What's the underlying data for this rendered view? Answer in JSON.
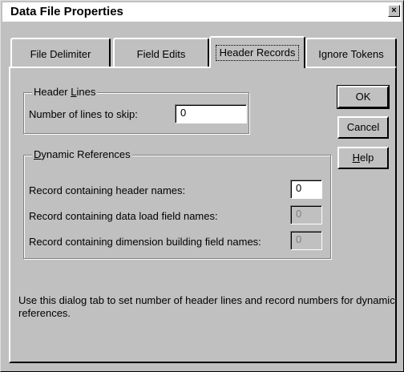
{
  "window": {
    "title": "Data File Properties",
    "close_glyph": "×"
  },
  "tabs": [
    {
      "label": "File Delimiter",
      "active": false
    },
    {
      "label": "Field Edits",
      "active": false
    },
    {
      "label": "Header Records",
      "active": true
    },
    {
      "label": "Ignore Tokens",
      "active": false
    }
  ],
  "header_lines": {
    "group_title_pre": "Header ",
    "group_title_u": "L",
    "group_title_post": "ines",
    "skip_label": "Number of lines to skip:",
    "skip_value": "0"
  },
  "dynamic_references": {
    "group_title_u": "D",
    "group_title_post": "ynamic References",
    "rows": [
      {
        "label": "Record containing header names:",
        "value": "0",
        "enabled": true
      },
      {
        "label": "Record containing data load field names:",
        "value": "0",
        "enabled": false
      },
      {
        "label": "Record containing dimension building field names:",
        "value": "0",
        "enabled": false
      }
    ]
  },
  "buttons": {
    "ok": "OK",
    "cancel": "Cancel",
    "help_u": "H",
    "help_post": "elp"
  },
  "description": "Use this dialog tab to set number of header lines and record numbers for dynamic references.",
  "icons": {
    "close": "close-icon"
  }
}
